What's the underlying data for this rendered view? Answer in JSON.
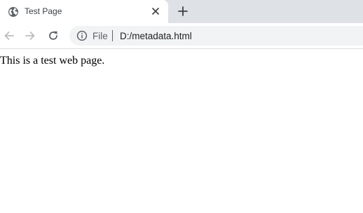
{
  "tab": {
    "title": "Test Page",
    "favicon": "globe-icon",
    "close_icon": "close-icon"
  },
  "newtab_icon": "plus-icon",
  "nav": {
    "back_icon": "arrow-left-icon",
    "forward_icon": "arrow-right-icon",
    "reload_icon": "reload-icon"
  },
  "omnibox": {
    "info_icon": "info-icon",
    "scheme_label": "File",
    "url": "D:/metadata.html"
  },
  "page": {
    "body_text": "This is a test web page."
  },
  "colors": {
    "tabstrip_bg": "#dee1e6",
    "omnibox_bg": "#f1f3f4",
    "icon_gray": "#5f6368",
    "disabled_gray": "#b9bcc0"
  }
}
